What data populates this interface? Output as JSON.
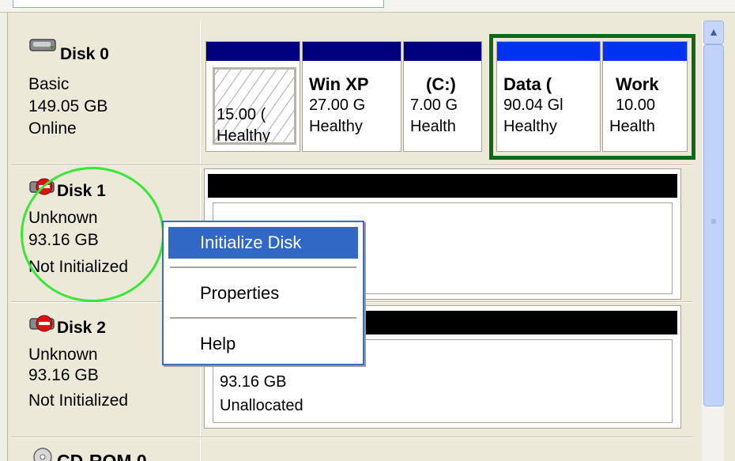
{
  "disks": [
    {
      "name": "Disk 0",
      "type": "Basic",
      "size": "149.05 GB",
      "status": "Online",
      "icon": "hard-disk-icon"
    },
    {
      "name": "Disk 1",
      "type": "Unknown",
      "size": "93.16 GB",
      "status": "Not Initialized",
      "icon": "disk-error-icon"
    },
    {
      "name": "Disk 2",
      "type": "Unknown",
      "size": "93.16 GB",
      "status": "Not Initialized",
      "icon": "disk-error-icon"
    },
    {
      "name": "CD-ROM 0",
      "icon": "cdrom-icon"
    }
  ],
  "disk0_partitions": [
    {
      "label": "",
      "size": "15.00 (",
      "status": "Healthy"
    },
    {
      "label": "Win XP",
      "size": "27.00 G",
      "status": "Healthy"
    },
    {
      "label": "(C:)",
      "size": "7.00 G",
      "status": "Health"
    },
    {
      "label": "Data  (",
      "size": "90.04 Gl",
      "status": "Healthy"
    },
    {
      "label": "Work",
      "size": "10.00",
      "status": "Health"
    }
  ],
  "disk2_unallocated": {
    "size": "93.16 GB",
    "status": "Unallocated"
  },
  "context_menu": {
    "items": [
      "Initialize Disk",
      "Properties",
      "Help"
    ],
    "selected": "Initialize Disk"
  },
  "colors": {
    "primary_partition": "#00007f",
    "logical_drive": "#0033ee",
    "extended_partition_border": "#0b6b18",
    "highlight_circle": "#39e639",
    "menu_selection": "#3168c6"
  }
}
